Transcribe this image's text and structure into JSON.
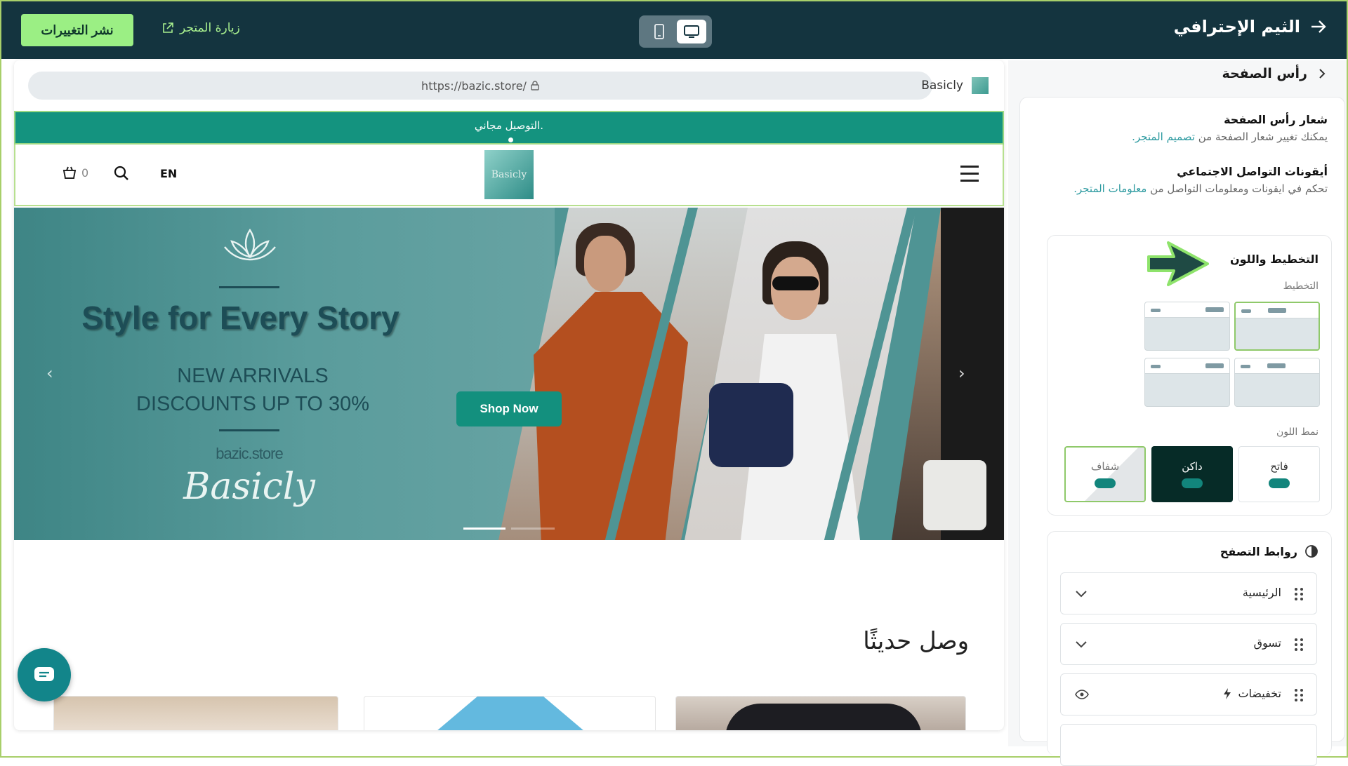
{
  "topbar": {
    "publish_label": "نشر التغييرات",
    "visit_store_label": "زيارة المتجر",
    "theme_title": "الثيم الإحترافي"
  },
  "preview": {
    "url": "https://bazic.store/",
    "site_name": "Basicly",
    "announcement": "التوصيل مجاني.",
    "language": "EN",
    "cart_count": "0",
    "logo_text": "Basicly",
    "hero": {
      "title": "Style for Every Story",
      "subtitle_line1": "NEW ARRIVALS",
      "subtitle_line2": "DISCOUNTS UP TO 30%",
      "domain": "bazic.store",
      "brand": "Basicly",
      "cta": "Shop Now"
    },
    "new_arrivals_title": "وصل حديثًا"
  },
  "panel": {
    "header": "رأس الصفحة",
    "logo_section": {
      "title": "شعار رأس الصفحة",
      "desc": "يمكنك تغيير شعار الصفحة من",
      "link": "تصميم المتجر."
    },
    "social_section": {
      "title": "أيقونات التواصل الاجتماعي",
      "desc": "تحكم في ايقونات ومعلومات التواصل من",
      "link": "معلومات المتجر."
    },
    "layout_color": {
      "title": "التخطيط واللون",
      "layout_label": "التخطيط",
      "color_mode_label": "نمط اللون",
      "color_options": [
        "فاتح",
        "داكن",
        "شفاف"
      ],
      "selected_color": "شفاف"
    },
    "nav_links": {
      "title": "روابط التصفح",
      "items": [
        "الرئيسية",
        "تسوق",
        "تخفيضات"
      ]
    }
  },
  "colors": {
    "topbar_bg": "#14343f",
    "publish_bg": "#9bef84",
    "accent_teal": "#14937f",
    "dark_mode_tile": "#062b27"
  }
}
